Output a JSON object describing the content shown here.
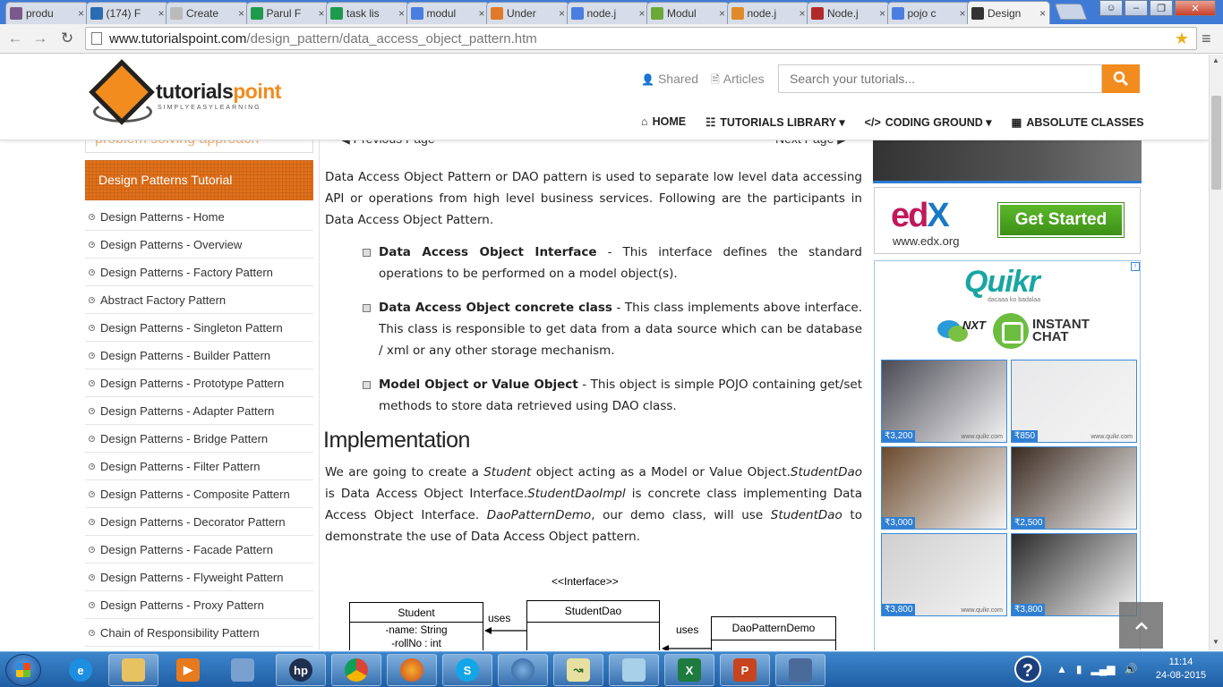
{
  "browser": {
    "tabs": [
      {
        "label": "produ",
        "icon": "hash-icon",
        "color": "#7a5a8a"
      },
      {
        "label": "(174) F",
        "icon": "quora-icon",
        "color": "#2b6cb0"
      },
      {
        "label": "Create",
        "icon": "doc-icon",
        "color": "#bbbbbb"
      },
      {
        "label": "Parul F",
        "icon": "sheets-icon",
        "color": "#1e9a4f"
      },
      {
        "label": "task lis",
        "icon": "sheets-icon",
        "color": "#1e9a4f"
      },
      {
        "label": "modul",
        "icon": "google-icon",
        "color": "#4a7ee0"
      },
      {
        "label": "Under",
        "icon": "arrow-icon",
        "color": "#e07a2a"
      },
      {
        "label": "node.j",
        "icon": "google-icon",
        "color": "#4a7ee0"
      },
      {
        "label": "Modul",
        "icon": "node-icon",
        "color": "#6aa83a"
      },
      {
        "label": "node.j",
        "icon": "stack-icon",
        "color": "#e08a2a"
      },
      {
        "label": "Node.j",
        "icon": "k-icon",
        "color": "#b02a2a"
      },
      {
        "label": "pojo c",
        "icon": "google-icon",
        "color": "#4a7ee0"
      },
      {
        "label": "Design",
        "icon": "tp-icon",
        "color": "#333333",
        "active": true
      }
    ],
    "url_host": "www.tutorialspoint.com",
    "url_path": "/design_pattern/data_access_object_pattern.htm"
  },
  "header": {
    "logo_main": "tutorials",
    "logo_main2": "point",
    "logo_sub": "SIMPLYEASYLEARNING",
    "shared": "Shared",
    "articles": "Articles",
    "search_placeholder": "Search your tutorials...",
    "nav": [
      "HOME",
      "TUTORIALS LIBRARY",
      "CODING GROUND",
      "ABSOLUTE CLASSES"
    ]
  },
  "sidebar": {
    "banner": "problem solving approach",
    "title": "Design Patterns Tutorial",
    "items": [
      "Design Patterns - Home",
      "Design Patterns - Overview",
      "Design Patterns - Factory Pattern",
      "Abstract Factory Pattern",
      "Design Patterns - Singleton Pattern",
      "Design Patterns - Builder Pattern",
      "Design Patterns - Prototype Pattern",
      "Design Patterns - Adapter Pattern",
      "Design Patterns - Bridge Pattern",
      "Design Patterns - Filter Pattern",
      "Design Patterns - Composite Pattern",
      "Design Patterns - Decorator Pattern",
      "Design Patterns - Facade Pattern",
      "Design Patterns - Flyweight Pattern",
      "Design Patterns - Proxy Pattern",
      "Chain of Responsibility Pattern"
    ]
  },
  "content": {
    "prev": "Previous Page",
    "next": "Next Page",
    "intro": "Data Access Object Pattern or DAO pattern is used to separate low level data accessing API or operations from high level business services. Following are the participants in Data Access Object Pattern.",
    "bullets": [
      {
        "term": "Data Access Object Interface",
        "desc": " - This interface defines the standard operations to be performed on a model object(s)."
      },
      {
        "term": "Data Access Object concrete class",
        "desc": " - This class implements above interface. This class is responsible to get data from a data source which can be database / xml or any other storage mechanism."
      },
      {
        "term": "Model Object or Value Object",
        "desc": " - This object is simple POJO containing get/set methods to store data retrieved using DAO class."
      }
    ],
    "heading": "Implementation",
    "impl": {
      "p1": "We are going to create a ",
      "e1": "Student",
      "p2": " object acting as a Model or Value Object.",
      "e2": "StudentDao",
      "p3": " is Data Access Object Interface.",
      "e3": "StudentDaoImpl",
      "p4": " is concrete class implementing Data Access Object Interface. ",
      "e4": "DaoPatternDemo",
      "p5": ", our demo class, will use ",
      "e5": "StudentDao",
      "p6": " to demonstrate the use of Data Access Object pattern."
    }
  },
  "uml": {
    "stereotype": "<<Interface>>",
    "student": "Student",
    "student_attr1": "-name: String",
    "student_attr2": "-rollNo : int",
    "dao": "StudentDao",
    "demo": "DaoPatternDemo",
    "uses1": "uses",
    "uses2": "uses"
  },
  "ads": {
    "edx_logo_a": "ed",
    "edx_logo_b": "X",
    "edx_url": "www.edx.org",
    "edx_button": "Get Started",
    "quikr_logo": "Quikr",
    "quikr_tag": "dacaaa ko badalaa",
    "nxt": "NXT",
    "instant_chat_1": "INSTANT",
    "instant_chat_2": "CHAT",
    "products": [
      {
        "price": "₹3,200",
        "watermark": "www.quikr.com",
        "color": "#4a4a55"
      },
      {
        "price": "₹850",
        "watermark": "www.quikr.com",
        "color": "#e8e8ea"
      },
      {
        "price": "₹3,000",
        "watermark": "",
        "color": "#6b4a2e"
      },
      {
        "price": "₹2,500",
        "watermark": "",
        "color": "#3a2a20"
      },
      {
        "price": "₹3,800",
        "watermark": "www.quikr.com",
        "color": "#d0d0d0"
      },
      {
        "price": "₹3,800",
        "watermark": "",
        "color": "#2a2a2a"
      }
    ]
  },
  "taskbar": {
    "time": "11:14",
    "date": "24-08-2015"
  }
}
